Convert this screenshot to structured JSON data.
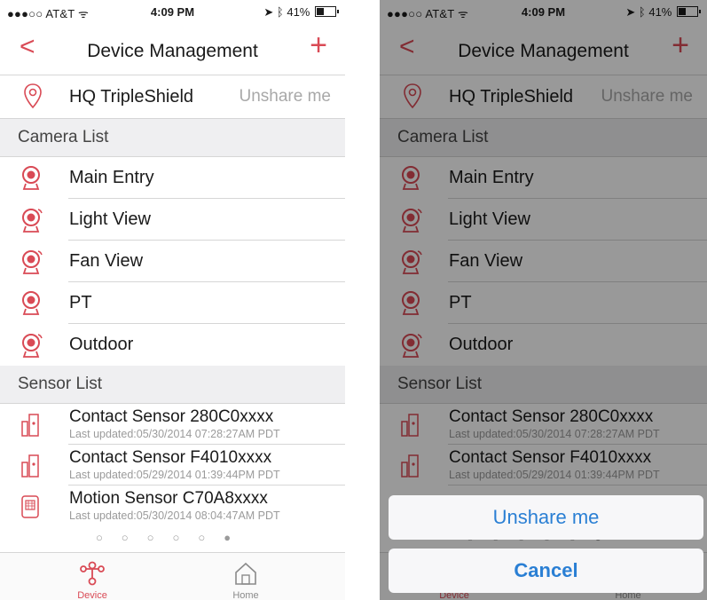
{
  "status_bar": {
    "carrier": "●●●○○ AT&T ᯤ",
    "time": "4:09 PM",
    "battery": "41%",
    "battery_level": 0.41
  },
  "nav": {
    "back": "<",
    "title": "Device Management",
    "add": "+"
  },
  "hq": {
    "name": "HQ TripleShield",
    "action": "Unshare me"
  },
  "camera_list": {
    "header": "Camera List",
    "items": [
      {
        "name": "Main Entry"
      },
      {
        "name": "Light View"
      },
      {
        "name": "Fan View"
      },
      {
        "name": "PT"
      },
      {
        "name": "Outdoor"
      }
    ]
  },
  "sensor_list": {
    "header": "Sensor List",
    "items": [
      {
        "name": "Contact Sensor 280C0xxxx",
        "updated": "Last updated:05/30/2014 07:28:27AM PDT"
      },
      {
        "name": "Contact Sensor F4010xxxx",
        "updated": "Last updated:05/29/2014 01:39:44PM PDT"
      },
      {
        "name": "Motion Sensor C70A8xxxx",
        "updated": "Last updated:05/30/2014 08:04:47AM PDT"
      }
    ]
  },
  "page_dots": "○○○○○●",
  "tabs": {
    "device": "Device",
    "home": "Home"
  },
  "action_sheet": {
    "unshare": "Unshare me",
    "cancel": "Cancel"
  },
  "colors": {
    "accent": "#d94a55",
    "ios_blue": "#2a7fd4"
  }
}
